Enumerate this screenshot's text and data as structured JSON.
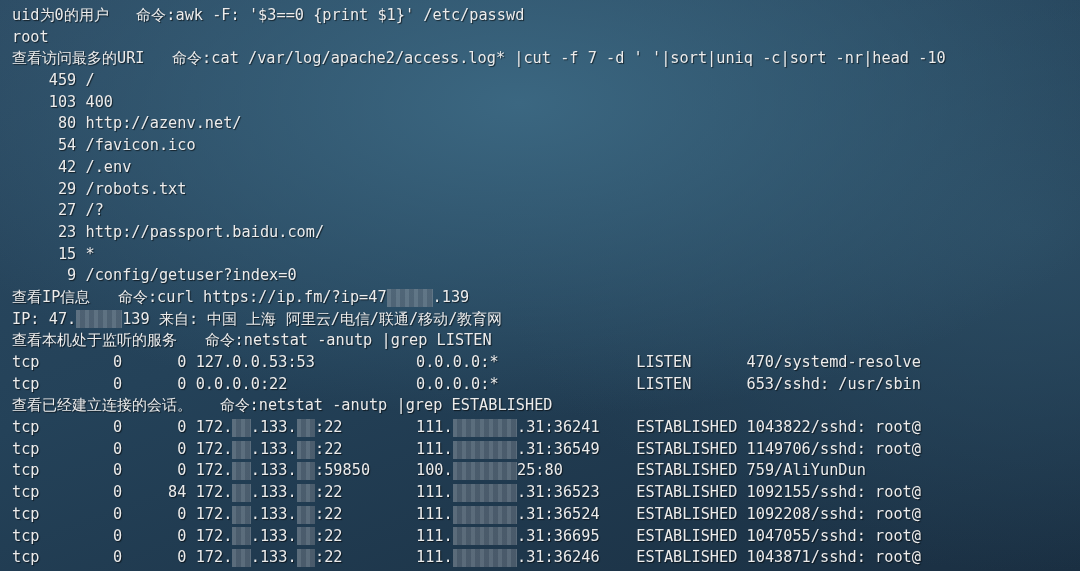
{
  "terminal": {
    "lines": [
      {
        "segments": [
          {
            "kind": "text",
            "text": "uid为0的用户   命令:awk -F: '$3==0 {print $1}' /etc/passwd"
          }
        ]
      },
      {
        "segments": [
          {
            "kind": "text",
            "text": "root"
          }
        ]
      },
      {
        "segments": [
          {
            "kind": "text",
            "text": "查看访问最多的URI   命令:cat /var/log/apache2/access.log* |cut -f 7 -d ' '|sort|uniq -c|sort -nr|head -10"
          }
        ]
      },
      {
        "segments": [
          {
            "kind": "text",
            "text": "    459 /"
          }
        ]
      },
      {
        "segments": [
          {
            "kind": "text",
            "text": "    103 400"
          }
        ]
      },
      {
        "segments": [
          {
            "kind": "text",
            "text": "     80 http://azenv.net/"
          }
        ]
      },
      {
        "segments": [
          {
            "kind": "text",
            "text": "     54 /favicon.ico"
          }
        ]
      },
      {
        "segments": [
          {
            "kind": "text",
            "text": "     42 /.env"
          }
        ]
      },
      {
        "segments": [
          {
            "kind": "text",
            "text": "     29 /robots.txt"
          }
        ]
      },
      {
        "segments": [
          {
            "kind": "text",
            "text": "     27 /?"
          }
        ]
      },
      {
        "segments": [
          {
            "kind": "text",
            "text": "     23 http://passport.baidu.com/"
          }
        ]
      },
      {
        "segments": [
          {
            "kind": "text",
            "text": "     15 *"
          }
        ]
      },
      {
        "segments": [
          {
            "kind": "text",
            "text": "      9 /config/getuser?index=0"
          }
        ]
      },
      {
        "segments": [
          {
            "kind": "text",
            "text": "查看IP信息   命令:curl https://ip.fm/?ip=47"
          },
          {
            "kind": "redacted_medium"
          },
          {
            "kind": "text",
            "text": ".139"
          }
        ]
      },
      {
        "segments": [
          {
            "kind": "text",
            "text": "IP: 47."
          },
          {
            "kind": "redacted_medium"
          },
          {
            "kind": "text",
            "text": "139 来自: 中国 上海 阿里云/电信/联通/移动/教育网"
          }
        ]
      },
      {
        "segments": [
          {
            "kind": "text",
            "text": "查看本机处于监听的服务   命令:netstat -anutp |grep LISTEN"
          }
        ]
      },
      {
        "segments": [
          {
            "kind": "text",
            "text": "tcp        0      0 127.0.0.53:53           0.0.0.0:*               LISTEN      470/systemd-resolve"
          }
        ]
      },
      {
        "segments": [
          {
            "kind": "text",
            "text": "tcp        0      0 0.0.0.0:22              0.0.0.0:*               LISTEN      653/sshd: /usr/sbin"
          }
        ]
      },
      {
        "segments": [
          {
            "kind": "text",
            "text": "查看已经建立连接的会话。   命令:netstat -anutp |grep ESTABLISHED"
          }
        ]
      },
      {
        "segments": [
          {
            "kind": "text",
            "text": "tcp        0      0 172."
          },
          {
            "kind": "redacted_short"
          },
          {
            "kind": "text",
            "text": ".133."
          },
          {
            "kind": "redacted_short"
          },
          {
            "kind": "text",
            "text": ":22        111."
          },
          {
            "kind": "redacted_long"
          },
          {
            "kind": "text",
            "text": ".31:36241    ESTABLISHED 1043822/sshd: root@"
          }
        ]
      },
      {
        "segments": [
          {
            "kind": "text",
            "text": "tcp        0      0 172."
          },
          {
            "kind": "redacted_short"
          },
          {
            "kind": "text",
            "text": ".133."
          },
          {
            "kind": "redacted_short"
          },
          {
            "kind": "text",
            "text": ":22        111."
          },
          {
            "kind": "redacted_long"
          },
          {
            "kind": "text",
            "text": ".31:36549    ESTABLISHED 1149706/sshd: root@"
          }
        ]
      },
      {
        "segments": [
          {
            "kind": "text",
            "text": "tcp        0      0 172."
          },
          {
            "kind": "redacted_short"
          },
          {
            "kind": "text",
            "text": ".133."
          },
          {
            "kind": "redacted_short"
          },
          {
            "kind": "text",
            "text": ":59850     100."
          },
          {
            "kind": "redacted_long"
          },
          {
            "kind": "text",
            "text": "25:80        ESTABLISHED 759/AliYunDun"
          }
        ]
      },
      {
        "segments": [
          {
            "kind": "text",
            "text": "tcp        0     84 172."
          },
          {
            "kind": "redacted_short"
          },
          {
            "kind": "text",
            "text": ".133."
          },
          {
            "kind": "redacted_short"
          },
          {
            "kind": "text",
            "text": ":22        111."
          },
          {
            "kind": "redacted_long"
          },
          {
            "kind": "text",
            "text": ".31:36523    ESTABLISHED 1092155/sshd: root@"
          }
        ]
      },
      {
        "segments": [
          {
            "kind": "text",
            "text": "tcp        0      0 172."
          },
          {
            "kind": "redacted_short"
          },
          {
            "kind": "text",
            "text": ".133."
          },
          {
            "kind": "redacted_short"
          },
          {
            "kind": "text",
            "text": ":22        111."
          },
          {
            "kind": "redacted_long"
          },
          {
            "kind": "text",
            "text": ".31:36524    ESTABLISHED 1092208/sshd: root@"
          }
        ]
      },
      {
        "segments": [
          {
            "kind": "text",
            "text": "tcp        0      0 172."
          },
          {
            "kind": "redacted_short"
          },
          {
            "kind": "text",
            "text": ".133."
          },
          {
            "kind": "redacted_short"
          },
          {
            "kind": "text",
            "text": ":22        111."
          },
          {
            "kind": "redacted_long"
          },
          {
            "kind": "text",
            "text": ".31:36695    ESTABLISHED 1047055/sshd: root@"
          }
        ]
      },
      {
        "segments": [
          {
            "kind": "text",
            "text": "tcp        0      0 172."
          },
          {
            "kind": "redacted_short"
          },
          {
            "kind": "text",
            "text": ".133."
          },
          {
            "kind": "redacted_short"
          },
          {
            "kind": "text",
            "text": ":22        111."
          },
          {
            "kind": "redacted_long"
          },
          {
            "kind": "text",
            "text": ".31:36246    ESTABLISHED 1043871/sshd: root@"
          }
        ]
      }
    ]
  }
}
